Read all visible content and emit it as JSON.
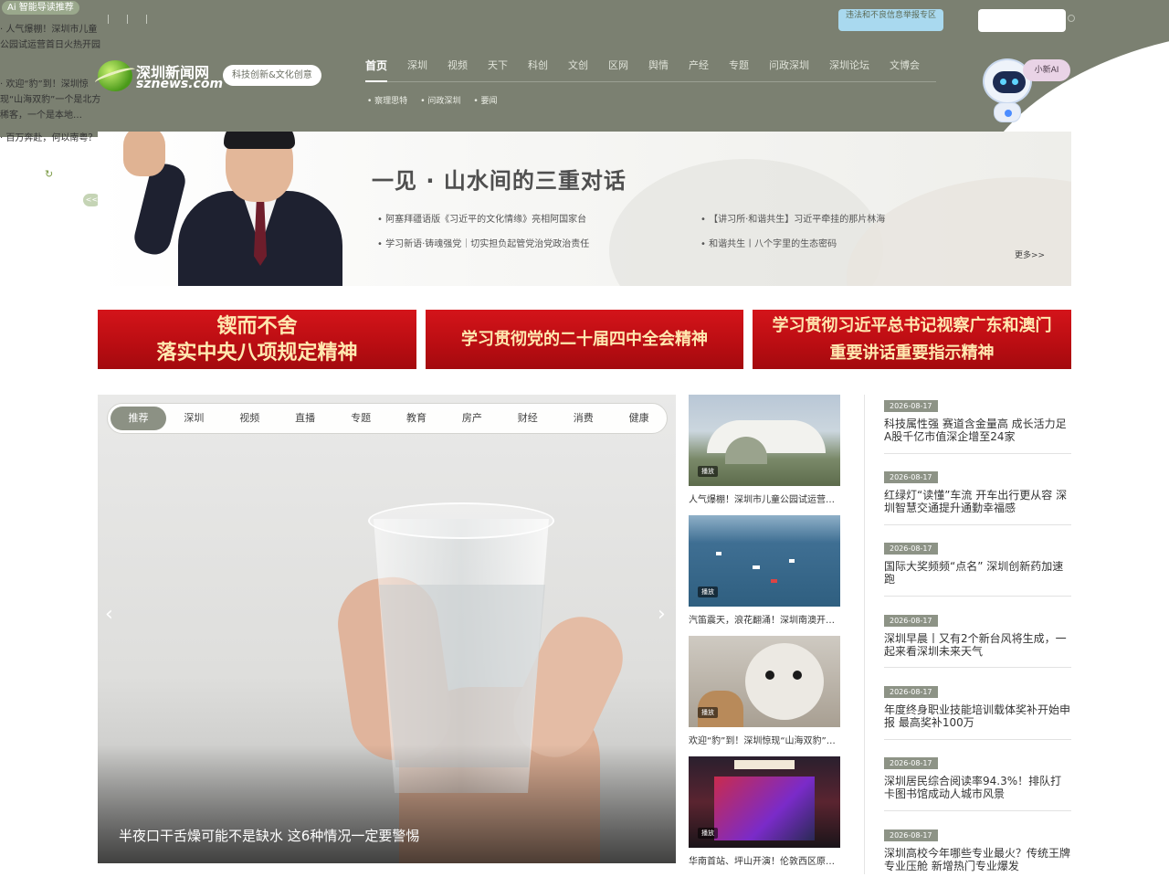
{
  "ai_panel": {
    "label": "Ai 智能导读推荐",
    "items": [
      "人气爆棚！深圳市儿童公园试运营首日火热开园",
      "欢迎“豹”到！深圳惊现“山海双豹”一个是北方稀客，一个是本地…",
      "百万奔赴，何以南粤？"
    ],
    "collapse": "<<"
  },
  "header": {
    "report_label": "违法和不良信息举报专区",
    "search_placeholder": "",
    "logo_cn": "深圳新闻网",
    "logo_en": "sznews.com",
    "slogan": "科技创新&文化创意",
    "robot_bubble": "小新AI"
  },
  "nav": {
    "items": [
      "首页",
      "深圳",
      "视频",
      "天下",
      "科创",
      "文创",
      "区网",
      "舆情",
      "产经",
      "专题",
      "问政深圳",
      "深圳论坛",
      "文博会"
    ],
    "sub": [
      "察理思特",
      "问政深圳",
      "要闻"
    ]
  },
  "hero": {
    "title": "一见 · 山水间的三重对话",
    "links": [
      "阿塞拜疆语版《习近平的文化情缘》亮相阿国家台",
      "【讲习所·和谐共生】习近平牵挂的那片林海",
      "学习新语·铸魂强党｜切实担负起管党治党政治责任",
      "和谐共生丨八个字里的生态密码"
    ],
    "more": "更多>>"
  },
  "banners": [
    {
      "lines": [
        "锲而不舍",
        "落实中央八项规定精神"
      ]
    },
    {
      "lines": [
        "学习贯彻党的二十届四中全会精神"
      ]
    },
    {
      "lines": [
        "学习贯彻习近平总书记视察广东和澳门",
        "重要讲话重要指示精神"
      ]
    }
  ],
  "carousel": {
    "tabs": [
      "推荐",
      "深圳",
      "视频",
      "直播",
      "专题",
      "教育",
      "房产",
      "财经",
      "消费",
      "健康"
    ],
    "caption": "半夜口干舌燥可能不是缺水 这6种情况一定要警惕"
  },
  "videos": [
    {
      "caption": "人气爆棚！深圳市儿童公园试运营…",
      "play": "播放"
    },
    {
      "caption": "汽笛震天，浪花翻涌！深圳南澳开…",
      "play": "播放"
    },
    {
      "caption": "欢迎“豹”到！深圳惊现“山海双豹”…",
      "play": "播放"
    },
    {
      "caption": "华南首站、坪山开演！伦敦西区原…",
      "play": "播放"
    }
  ],
  "news": [
    {
      "date": "2026-08-17",
      "title": "科技属性强 赛道含金量高 成长活力足 A股千亿市值深企增至24家"
    },
    {
      "date": "2026-08-17",
      "title": "红绿灯“读懂”车流 开车出行更从容 深圳智慧交通提升通勤幸福感"
    },
    {
      "date": "2026-08-17",
      "title": "国际大奖频频“点名” 深圳创新药加速跑"
    },
    {
      "date": "2026-08-17",
      "title": "深圳早晨丨又有2个新台风将生成，一起来看深圳未来天气"
    },
    {
      "date": "2026-08-17",
      "title": "年度终身职业技能培训载体奖补开始申报 最高奖补100万"
    },
    {
      "date": "2026-08-17",
      "title": "深圳居民综合阅读率94.3%！排队打卡图书馆成动人城市风景"
    },
    {
      "date": "2026-08-17",
      "title": "深圳高校今年哪些专业最火？传统王牌专业压舱 新增热门专业爆发"
    }
  ],
  "colors": {
    "header": "#7b8071",
    "banner_red": "#c41016",
    "accent": "#8c9184"
  }
}
